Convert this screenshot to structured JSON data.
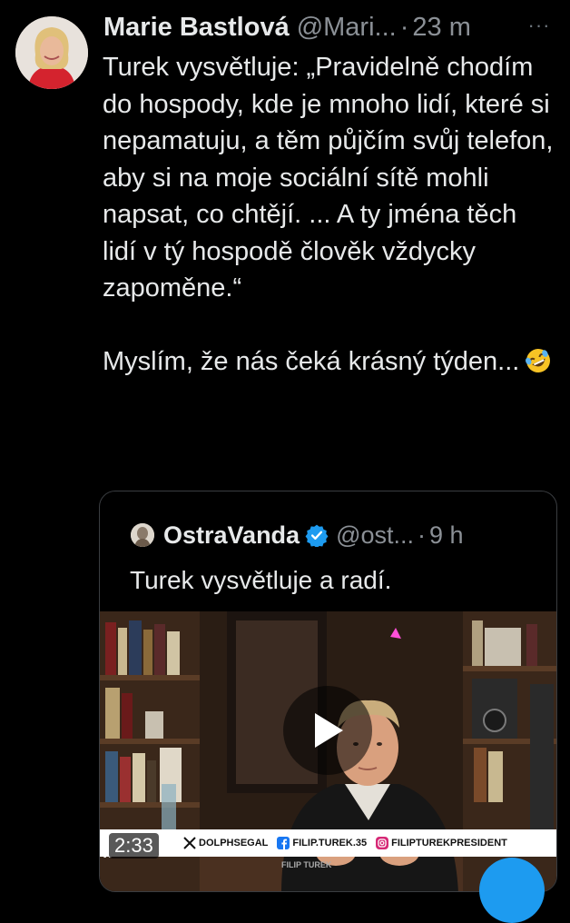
{
  "tweet": {
    "author_name": "Marie Bastlová",
    "author_handle": "@Mari...",
    "separator": "·",
    "time": "23 m",
    "more_label": "···",
    "paragraph_1": "Turek vysvětluje: „Pravidelně chodím do hospody, kde je mnoho lidí, které si nepamatuju, a těm půjčím svůj telefon, aby si na moje sociální sítě mohli napsat, co chtějí. ... A ty jména těch lidí v tý hospodě člověk vždycky zapoměne.“",
    "paragraph_2": "Myslím, že nás čeká krásný týden...",
    "emoji": "rolling-on-the-floor-laughing"
  },
  "quoted_tweet": {
    "author_name": "OstraVanda",
    "author_handle": "@ost...",
    "separator": "·",
    "time": "9 h",
    "text": "Turek vysvětluje a radí.",
    "video": {
      "duration": "2:33",
      "banner": {
        "x_handle": "DOLPHSEGAL",
        "facebook_handle": "FILIP.TUREK.35",
        "instagram_handle": "FILIPTUREKPRESIDENT"
      },
      "name_strip": "FILIP TUREK",
      "close_glyph": "x"
    }
  },
  "colors": {
    "background": "#000000",
    "text": "#e7e9ea",
    "secondary_text": "#8b9096",
    "verified_badge": "#1d9bf0",
    "quote_border": "#3a3d41"
  },
  "icons": [
    "more-icon",
    "verified-icon",
    "play-icon",
    "x-logo-icon",
    "facebook-icon",
    "instagram-icon",
    "compose-fab-icon"
  ]
}
